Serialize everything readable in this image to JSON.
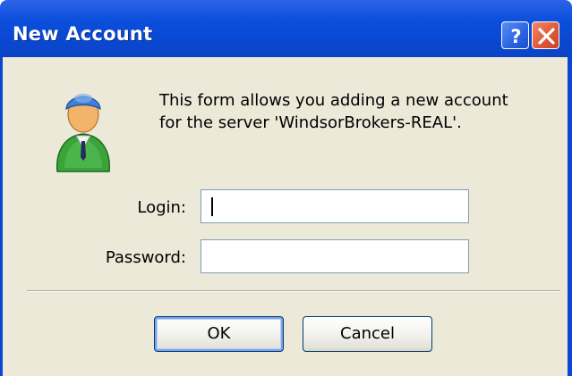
{
  "window": {
    "title": "New Account",
    "help_icon": "help-icon",
    "close_icon": "close-icon",
    "colors": {
      "titlebar": "#0a48d2",
      "body": "#ece9d8",
      "close": "#e05a3a"
    }
  },
  "form": {
    "avatar_icon": "user-avatar-icon",
    "description_line1": "This form allows you adding a new account",
    "description_line2": "for the server 'WindsorBrokers-REAL'.",
    "login_label": "Login:",
    "login_value": "",
    "password_label": "Password:",
    "password_value": ""
  },
  "buttons": {
    "ok_label": "OK",
    "cancel_label": "Cancel"
  }
}
